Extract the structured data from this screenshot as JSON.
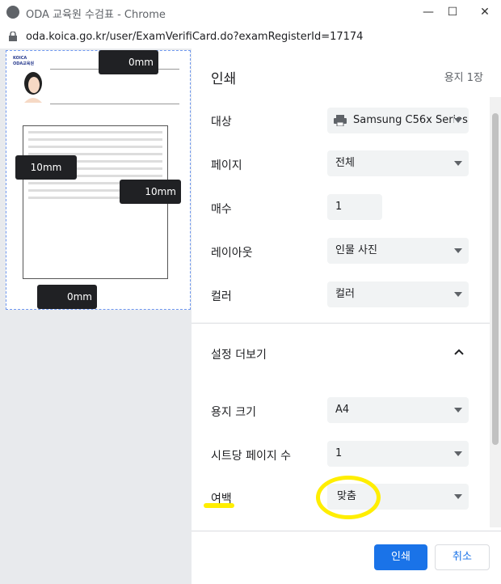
{
  "window": {
    "title": "ODA 교육원 수검표 - Chrome",
    "url": "oda.koica.go.kr/user/ExamVerifiCard.do?examRegisterId=17174"
  },
  "preview": {
    "margin_top": "0mm",
    "margin_left": "10mm",
    "margin_right": "10mm",
    "margin_bottom": "0mm",
    "logo_text_1": "KOICA",
    "logo_text_2": "ODA교육원"
  },
  "print": {
    "title": "인쇄",
    "page_count": "용지 1장",
    "destination_label": "대상",
    "destination_value": "Samsung C56x Series",
    "pages_label": "페이지",
    "pages_value": "전체",
    "copies_label": "매수",
    "copies_value": "1",
    "layout_label": "레이아웃",
    "layout_value": "인물 사진",
    "color_label": "컬러",
    "color_value": "컬러",
    "more_settings_label": "설정 더보기",
    "paper_size_label": "용지 크기",
    "paper_size_value": "A4",
    "pages_per_sheet_label": "시트당 페이지 수",
    "pages_per_sheet_value": "1",
    "margins_label": "여백",
    "margins_value": "맞춤",
    "print_button": "인쇄",
    "cancel_button": "취소"
  },
  "colors": {
    "accent": "#1a73e8",
    "highlight": "#ffee00"
  }
}
